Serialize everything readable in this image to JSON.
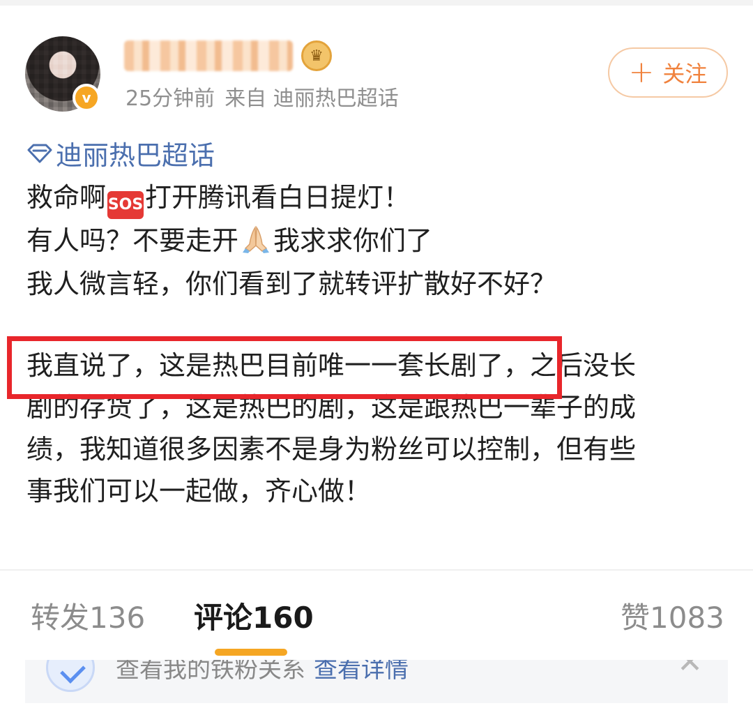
{
  "header": {
    "time": "25分钟前",
    "source": "来自 迪丽热巴超话",
    "follow_label": "关注",
    "verified_icon": "v-badge-icon"
  },
  "topic": {
    "label": "迪丽热巴超话",
    "color": "#4b6fae"
  },
  "post": {
    "line1_before": "救命啊",
    "sos_label": "SOS",
    "line1_after": "打开腾讯看白日提灯！",
    "line2_before": "有人吗？不要走开",
    "line2_after": "我求求你们了",
    "line3": "我人微言轻，你们看到了就转评扩散好不好？",
    "para2_lines": [
      "我直说了，这是热巴目前唯一一套长剧了，之后没长",
      "剧的存货了，这是热巴的剧，这是跟热巴一辈子的成",
      "绩，我知道很多因素不是身为粉丝可以控制，但有些",
      "事我们可以一起做，齐心做！"
    ],
    "highlight_color": "#e8262b"
  },
  "stats": {
    "repost": "转发136",
    "comment": "评论160",
    "like": "赞1083",
    "active_tab": "comment",
    "indicator_color": "#f5a623"
  },
  "banner": {
    "text": "查看我的铁粉关系",
    "link": "查看详情",
    "close": "✕"
  }
}
